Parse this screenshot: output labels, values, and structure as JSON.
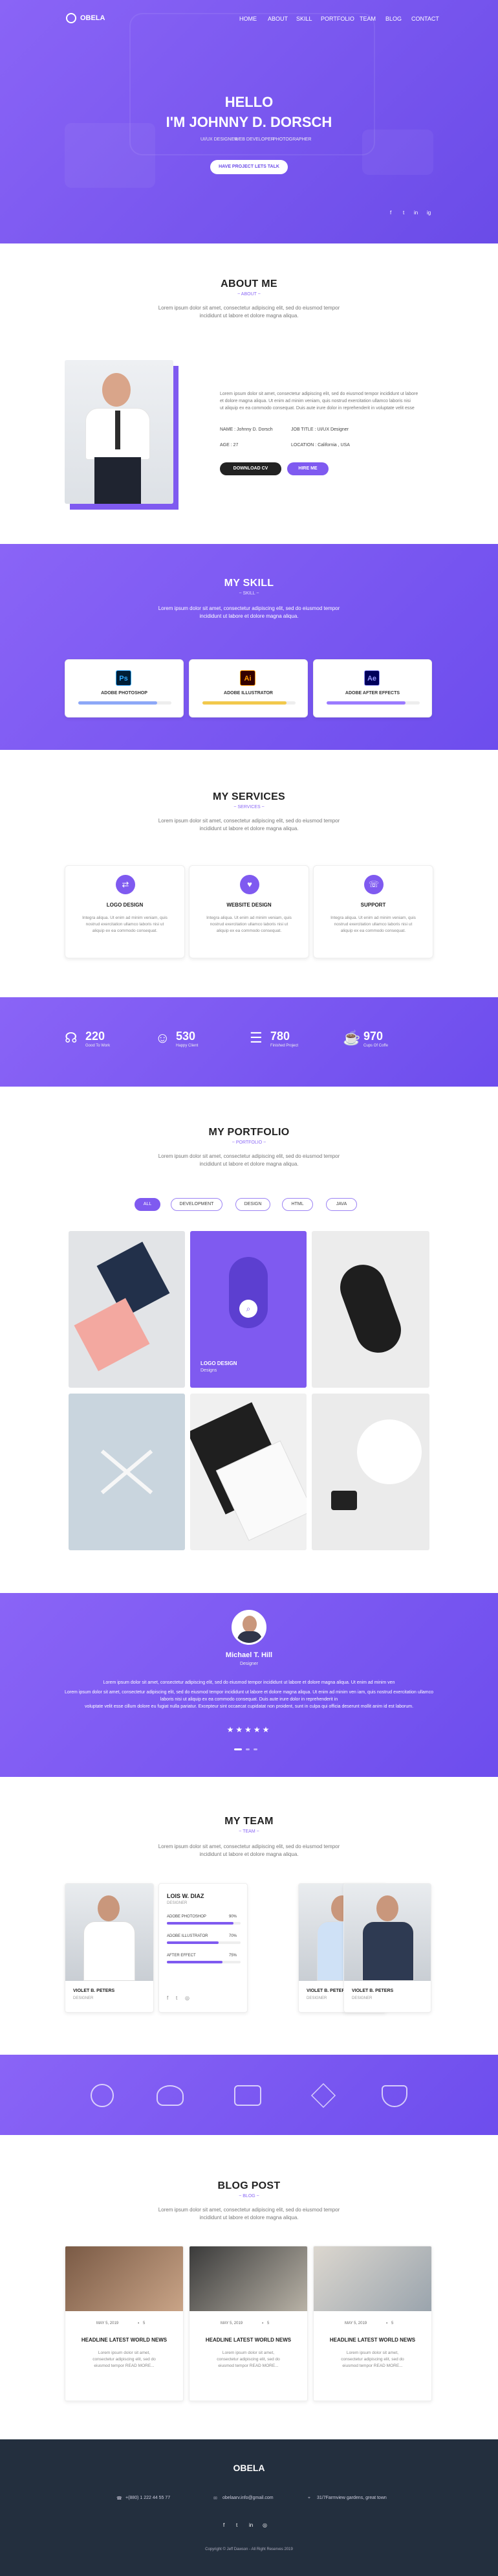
{
  "brand": {
    "logo_text": "OBELA"
  },
  "nav": [
    "HOME",
    "ABOUT",
    "SKILL",
    "PORTFOLIO",
    "TEAM",
    "BLOG",
    "CONTACT"
  ],
  "hero": {
    "hello": "HELLO",
    "name": "I'M JOHNNY D. DORSCH",
    "roles": [
      "UI/UX DESIGNER",
      "WEB DEVELOPER",
      "PHOTOGRAPHER"
    ],
    "cta": "HAVE PROJECT LETS TALK",
    "socials": [
      "f",
      "t",
      "in",
      "ig"
    ]
  },
  "about": {
    "title": "ABOUT ME",
    "sub": "~ ABOUT ~",
    "intro": [
      "Lorem ipsum dolor sit amet, consectetur adipiscing elit, sed do eiusmod tempor",
      "incididunt ut labore et dolore magna aliqua."
    ],
    "para": [
      "Lorem ipsum dolor sit amet, consectetur adipiscing elit, sed do eiusmod tempor incididunt ut labore",
      "et dolore magna aliqua. Ut enim ad minim veniam, quis nostrud exercitation ullamco laboris nisi",
      "ut aliquip ex ea commodo consequat. Duis aute irure dolor in reprehenderit in voluptate velit esse"
    ],
    "name": "NAME : Johnny D. Dorsch",
    "job": "JOB TITLE : UI/UX Designer",
    "age": "AGE : 27",
    "location": "LOCATION : California , USA",
    "download": "DOWNLOAD CV",
    "hire": "HIRE ME"
  },
  "skill": {
    "title": "MY SKILL",
    "sub": "~ SKILL ~",
    "intro": [
      "Lorem ipsum dolor sit amet, consectetur adipiscing elit, sed do eiusmod tempor",
      "incididunt ut labore et dolore magna aliqua."
    ],
    "items": [
      {
        "abbr": "Ps",
        "name": "ADOBE PHOTOSHOP",
        "level": 0.85,
        "bar": "#8da8f7",
        "bg": "#001e36",
        "fg": "#31a8ff"
      },
      {
        "abbr": "Ai",
        "name": "ADOBE ILLUSTRATOR",
        "level": 0.9,
        "bar": "#f2c94c",
        "bg": "#330000",
        "fg": "#ff9a00"
      },
      {
        "abbr": "Ae",
        "name": "ADOBE AFTER EFFECTS",
        "level": 0.85,
        "bar": "#9b7bff",
        "bg": "#00005b",
        "fg": "#9999ff"
      }
    ]
  },
  "services": {
    "title": "MY SERVICES",
    "sub": "~ SERVICES ~",
    "intro": [
      "Lorem ipsum dolor sit amet, consectetur adipiscing elit, sed do eiusmod tempor",
      "incididunt ut labore et dolore magna aliqua."
    ],
    "items": [
      {
        "icon": "code-icon",
        "glyph": "⇄",
        "name": "LOGO DESIGN"
      },
      {
        "icon": "heart-icon",
        "glyph": "♥",
        "name": "WEBSITE DESIGN"
      },
      {
        "icon": "support-icon",
        "glyph": "☏",
        "name": "SUPPORT"
      }
    ],
    "text": [
      "Integra aliqua. Ut enim ad minim veniam, quis",
      "nostrud exercitation ullamco laboris nisi ut",
      "aliquip ex ea commodo consequat."
    ]
  },
  "counters": [
    {
      "icon": "headphones-icon",
      "glyph": "☊",
      "num": "220",
      "label": "Good To Work"
    },
    {
      "icon": "smile-icon",
      "glyph": "☺",
      "num": "530",
      "label": "Happy Client"
    },
    {
      "icon": "list-icon",
      "glyph": "☰",
      "num": "780",
      "label": "Finished Project"
    },
    {
      "icon": "coffee-icon",
      "glyph": "☕",
      "num": "970",
      "label": "Cups Of Coffe"
    }
  ],
  "portfolio": {
    "title": "MY PORTFOLIO",
    "sub": "~ PORTFOLIO ~",
    "intro": [
      "Lorem ipsum dolor sit amet, consectetur adipiscing elit, sed do eiusmod tempor",
      "incididunt ut labore et dolore magna aliqua."
    ],
    "filters": [
      "ALL",
      "DEVELOPMENT",
      "DESIGN",
      "HTML",
      "JAVA"
    ],
    "overlay_label": "LOGO DESIGN",
    "overlay_sub": "Designs"
  },
  "testimonial": {
    "name": "Michael T. Hill",
    "role": "Designer",
    "text": [
      "Lorem ipsum dolor sit amet, consectetur adipiscing elit, sed do eiusmod tempor incididunt ut labore et dolore magna aliqua. Ut enim ad minim ven",
      "Lorem ipsum dolor sit amet, consectetur adipiscing elit, sed do eiusmod tempor incididunt ut labore et dolore magna aliqua. Ut enim ad minim ven iam, quis nostrud exercitation ullamco laboris nisi ut aliquip ex ea commodo consequat. Duis aute irure dolor in reprehenderit in",
      "voluptate velit esse cillum dolore eu fugiat nulla pariatur. Excepteur sint occaecat cupidatat non proident, sunt in culpa qui officia deserunt mollit anim id est laborum."
    ],
    "stars": "★★★★★"
  },
  "team": {
    "title": "MY TEAM",
    "sub": "~ TEAM ~",
    "intro": [
      "Lorem ipsum dolor sit amet, consectetur adipiscing elit, sed do eiusmod tempor",
      "incididunt ut labore et dolore magna aliqua."
    ],
    "members": [
      {
        "name": "VIOLET B. PETERS",
        "role": "DESIGNER"
      },
      {
        "name": "VIOLET B. PETERS",
        "role": "DESIGNER"
      },
      {
        "name": "VIOLET B. PETERS",
        "role": "DESIGNER"
      }
    ],
    "featured": {
      "name": "LOIS W. DIAZ",
      "role": "DESIGNER",
      "skills": [
        {
          "name": "ADOBE PHOTOSHOP",
          "pct": "90%",
          "level": 0.9
        },
        {
          "name": "ADOBE ILLUSTRATOR",
          "pct": "70%",
          "level": 0.7
        },
        {
          "name": "AFTER EFFECT",
          "pct": "75%",
          "level": 0.75
        }
      ]
    }
  },
  "blog": {
    "title": "BLOG POST",
    "sub": "~ BLOG ~",
    "intro": [
      "Lorem ipsum dolor sit amet, consectetur adipiscing elit, sed do eiusmod tempor",
      "incididunt ut labore et dolore magna aliqua."
    ],
    "posts": [
      {
        "date": "MAY 5, 2019",
        "comments": "5",
        "title": "HEADLINE LATEST WORLD NEWS"
      },
      {
        "date": "MAY 5, 2019",
        "comments": "5",
        "title": "HEADLINE LATEST WORLD NEWS"
      },
      {
        "date": "MAY 5, 2019",
        "comments": "5",
        "title": "HEADLINE LATEST WORLD NEWS"
      }
    ],
    "excerpt": [
      "Lorem ipsum dolor sit amet,",
      "consectetur adipiscing elit, sed do",
      "eiusmod tempor READ MORE..."
    ]
  },
  "footer": {
    "logo": "OBELA",
    "phone": "+(880) 1 222 44 55 77",
    "email": "obelaarv.info@gmail.com",
    "address": "31/7Farmview gardens, great town",
    "copyright": "Copyright © Jeff Dawson - All Right Reserves 2019"
  },
  "colors": {
    "accent": "#7f5af0",
    "dark": "#232f3e"
  }
}
